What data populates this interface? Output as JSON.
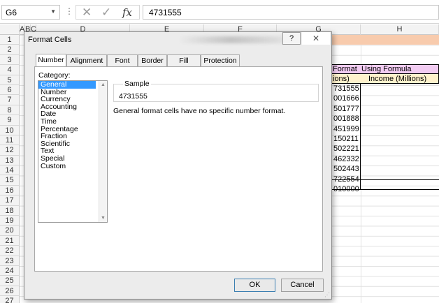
{
  "formula_bar": {
    "name_box": "G6",
    "cancel_glyph": "✕",
    "enter_glyph": "✓",
    "fx_label": "fx",
    "value": "4731555"
  },
  "columns": [
    "A",
    "B",
    "C",
    "D",
    "E",
    "F",
    "G",
    "H"
  ],
  "rows": [
    "1",
    "2",
    "3",
    "4",
    "5",
    "6",
    "7",
    "8",
    "9",
    "10",
    "11",
    "12",
    "13",
    "14",
    "15",
    "16",
    "17",
    "18",
    "19",
    "20",
    "21",
    "22",
    "23",
    "24",
    "25",
    "26",
    "27"
  ],
  "sheet": {
    "g3": "Format",
    "h3": "Using Formula",
    "g5": "ions)",
    "h5": "Income (Millions)",
    "g_values": [
      "731555",
      "001666",
      "501777",
      "001888",
      "451999",
      "150211",
      "502221",
      "462332",
      "502443",
      "722554",
      "010000"
    ]
  },
  "dialog": {
    "title": "Format Cells",
    "help": "?",
    "close": "✕",
    "tabs": [
      "Number",
      "Alignment",
      "Font",
      "Border",
      "Fill",
      "Protection"
    ],
    "category_label": "Category:",
    "categories": [
      "General",
      "Number",
      "Currency",
      "Accounting",
      "Date",
      "Time",
      "Percentage",
      "Fraction",
      "Scientific",
      "Text",
      "Special",
      "Custom"
    ],
    "selected_category": "General",
    "sample_label": "Sample",
    "sample_value": "4731555",
    "description": "General format cells have no specific number format.",
    "ok": "OK",
    "cancel": "Cancel"
  }
}
